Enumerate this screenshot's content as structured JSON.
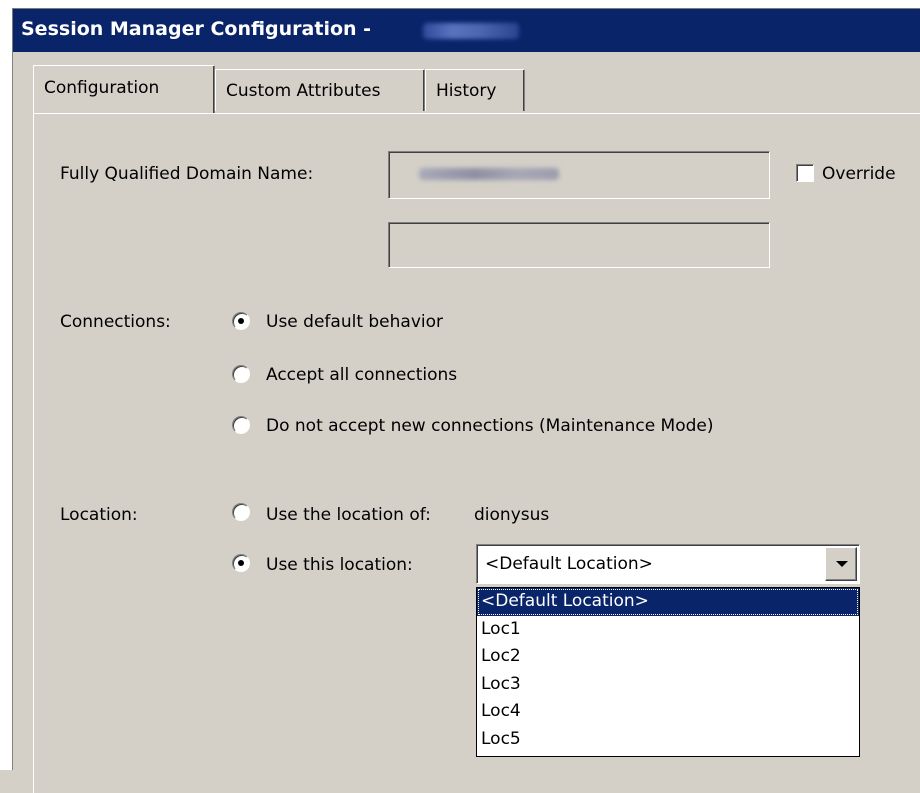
{
  "window": {
    "title": "Session Manager Configuration -"
  },
  "tabs": [
    {
      "label": "Configuration"
    },
    {
      "label": "Custom Attributes"
    },
    {
      "label": "History"
    }
  ],
  "fqdn": {
    "label": "Fully Qualified Domain Name:",
    "override_label": "Override"
  },
  "connections": {
    "label": "Connections:",
    "options": [
      {
        "label": "Use default behavior",
        "checked": true
      },
      {
        "label": "Accept all connections",
        "checked": false
      },
      {
        "label": "Do not accept new connections (Maintenance Mode)",
        "checked": false
      }
    ]
  },
  "location": {
    "label": "Location:",
    "use_location_of": "Use the location of:",
    "location_of_value": "dionysus",
    "use_this_location": "Use this location:",
    "selected_value": "<Default Location>",
    "dropdown_options": [
      "<Default Location>",
      "Loc1",
      "Loc2",
      "Loc3",
      "Loc4",
      "Loc5"
    ]
  }
}
